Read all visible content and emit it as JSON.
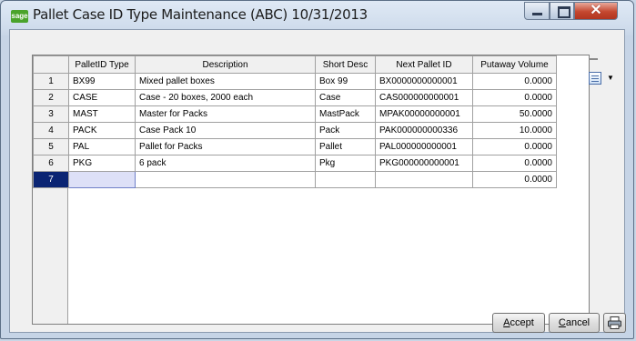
{
  "window": {
    "title": "Pallet Case ID Type Maintenance (ABC) 10/31/2013",
    "app_icon_text": "sage",
    "controls": [
      "minimize",
      "maximize",
      "close"
    ]
  },
  "grid": {
    "columns": [
      "PalletID Type",
      "Description",
      "Short Desc",
      "Next Pallet ID",
      "Putaway Volume"
    ],
    "rows": [
      {
        "num": "1",
        "id": "BX99",
        "desc": "Mixed pallet boxes",
        "short": "Box 99",
        "next": "BX0000000000001",
        "putaway": "0.0000"
      },
      {
        "num": "2",
        "id": "CASE",
        "desc": "Case - 20 boxes, 2000 each",
        "short": "Case",
        "next": "CAS000000000001",
        "putaway": "0.0000"
      },
      {
        "num": "3",
        "id": "MAST",
        "desc": "Master for Packs",
        "short": "MastPack",
        "next": "MPAK00000000001",
        "putaway": "50.0000"
      },
      {
        "num": "4",
        "id": "PACK",
        "desc": "Case Pack 10",
        "short": "Pack",
        "next": "PAK000000000336",
        "putaway": "10.0000"
      },
      {
        "num": "5",
        "id": "PAL",
        "desc": "Pallet for Packs",
        "short": "Pallet",
        "next": "PAL000000000001",
        "putaway": "0.0000"
      },
      {
        "num": "6",
        "id": "PKG",
        "desc": "6 pack",
        "short": "Pkg",
        "next": "PKG000000000001",
        "putaway": "0.0000"
      },
      {
        "num": "7",
        "id": "",
        "desc": "",
        "short": "",
        "next": "",
        "putaway": "0.0000"
      }
    ],
    "selected_row": "7"
  },
  "buttons": {
    "accept": {
      "pre": "",
      "accel": "A",
      "post": "ccept"
    },
    "cancel": {
      "pre": "",
      "accel": "C",
      "post": "ancel"
    },
    "print_icon": "printer-icon"
  },
  "colors": {
    "selected_row_header": "#0a2473",
    "edit_cell": "#dde0f7",
    "close_button": "#c4472f"
  }
}
